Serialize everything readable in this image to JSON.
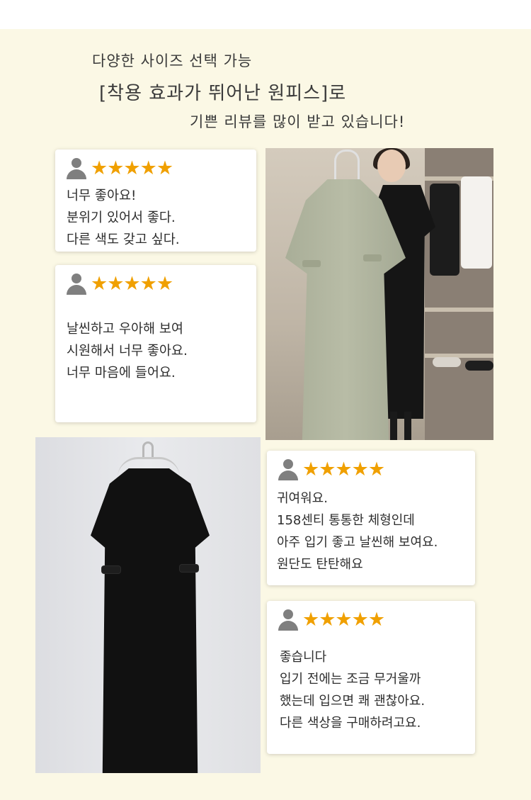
{
  "header": {
    "line1": "다양한 사이즈 선택 가능",
    "line2": "[착용 효과가 뛰어난 원피스]로",
    "line3": "기쁜 리뷰를 많이 받고 있습니다!"
  },
  "reviews": [
    {
      "stars": "★★★★★",
      "rating": 5,
      "lines": [
        "너무 좋아요!",
        "분위기 있어서 좋다.",
        "다른 색도 갖고 싶다."
      ]
    },
    {
      "stars": "★★★★★",
      "rating": 5,
      "lines": [
        "날씬하고 우아해 보여",
        "시원해서 너무 좋아요.",
        "너무 마음에 들어요."
      ]
    },
    {
      "stars": "★★★★★",
      "rating": 5,
      "lines": [
        "귀여워요.",
        "158센티 통통한 체형인데",
        "아주 입기 좋고 날씬해 보여요.",
        "원단도 탄탄해요"
      ]
    },
    {
      "stars": "★★★★★",
      "rating": 5,
      "lines": [
        "좋습니다",
        "입기 전에는 조금 무거울까",
        "했는데 입으면 쾌 괜찮아요.",
        "다른 색상을 구매하려고요."
      ]
    }
  ],
  "colors": {
    "background": "#fbf8e5",
    "star": "#f0a000",
    "avatar": "#7f7f7f"
  },
  "icons": {
    "avatar": "user-avatar-icon",
    "star": "star-icon"
  }
}
